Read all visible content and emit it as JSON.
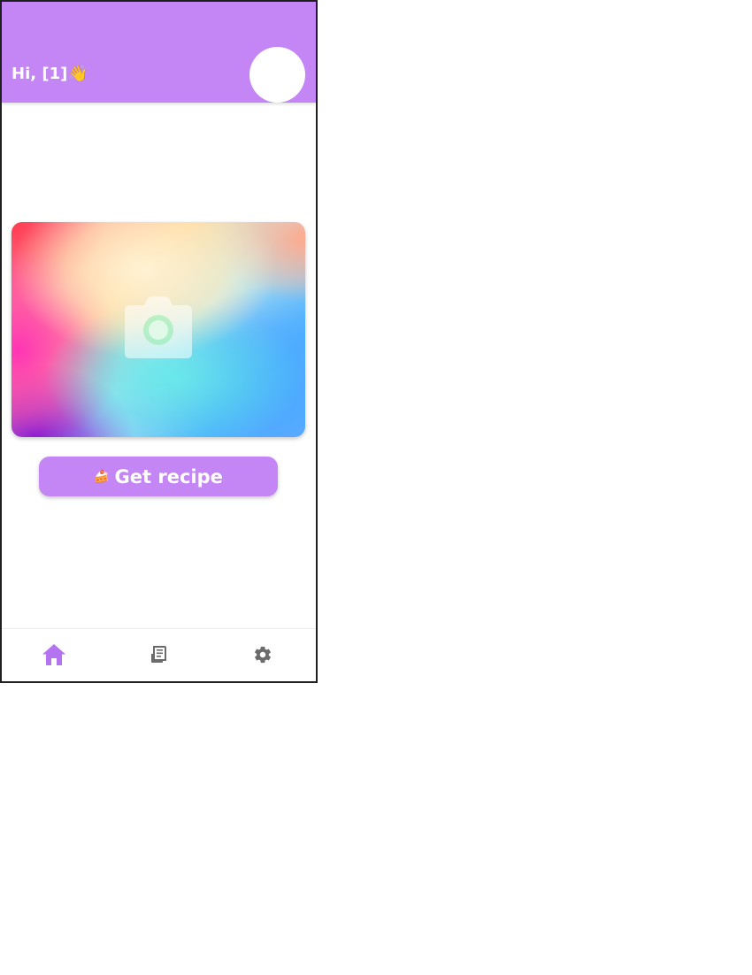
{
  "header": {
    "greeting": "Hi, [1]",
    "wave_emoji": "👋",
    "avatar_icon": "avatar"
  },
  "main": {
    "image_placeholder_icon": "camera-icon",
    "get_recipe_button": {
      "icon": "🍰",
      "label": "Get recipe"
    }
  },
  "bottom_nav": {
    "items": [
      {
        "icon": "home-icon",
        "active": true
      },
      {
        "icon": "recipe-book-icon",
        "active": false
      },
      {
        "icon": "gear-icon",
        "active": false
      }
    ]
  },
  "colors": {
    "accent": "#c386f4",
    "nav_active": "#b473f0",
    "nav_inactive": "#6b6b6b"
  }
}
